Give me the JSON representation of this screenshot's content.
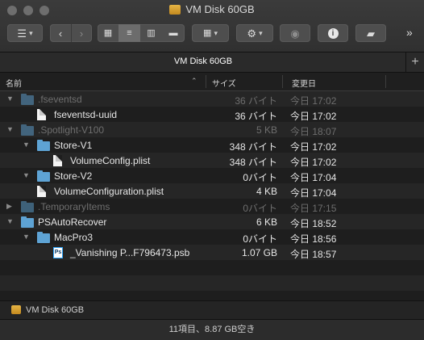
{
  "window": {
    "title": "VM Disk 60GB"
  },
  "tab": {
    "label": "VM Disk 60GB",
    "add_label": "+"
  },
  "toolbar": {
    "overflow_label": "»"
  },
  "columns": {
    "name": "名前",
    "size": "サイズ",
    "modified": "変更日"
  },
  "rows": [
    {
      "name": ".fseventsd",
      "size": "36 バイト",
      "date": "今日 17:02",
      "kind": "folder",
      "depth": 0,
      "expanded": true,
      "dim": true
    },
    {
      "name": "fseventsd-uuid",
      "size": "36 バイト",
      "date": "今日 17:02",
      "kind": "file",
      "depth": 1,
      "expanded": false,
      "dim": false
    },
    {
      "name": ".Spotlight-V100",
      "size": "5 KB",
      "date": "今日 18:07",
      "kind": "folder",
      "depth": 0,
      "expanded": true,
      "dim": true
    },
    {
      "name": "Store-V1",
      "size": "348 バイト",
      "date": "今日 17:02",
      "kind": "folder",
      "depth": 1,
      "expanded": true,
      "dim": false
    },
    {
      "name": "VolumeConfig.plist",
      "size": "348 バイト",
      "date": "今日 17:02",
      "kind": "file",
      "depth": 2,
      "expanded": false,
      "dim": false
    },
    {
      "name": "Store-V2",
      "size": "0バイト",
      "date": "今日 17:04",
      "kind": "folder",
      "depth": 1,
      "expanded": true,
      "dim": false
    },
    {
      "name": "VolumeConfiguration.plist",
      "size": "4 KB",
      "date": "今日 17:04",
      "kind": "file",
      "depth": 1,
      "expanded": false,
      "dim": false
    },
    {
      "name": ".TemporaryItems",
      "size": "0バイト",
      "date": "今日 17:15",
      "kind": "folder",
      "depth": 0,
      "expanded": false,
      "dim": true
    },
    {
      "name": "PSAutoRecover",
      "size": "6 KB",
      "date": "今日 18:52",
      "kind": "folder",
      "depth": 0,
      "expanded": true,
      "dim": false
    },
    {
      "name": "MacPro3",
      "size": "0バイト",
      "date": "今日 18:56",
      "kind": "folder",
      "depth": 1,
      "expanded": true,
      "dim": false
    },
    {
      "name": "_Vanishing P...F796473.psb",
      "size": "1.07 GB",
      "date": "今日 18:57",
      "kind": "psd",
      "depth": 2,
      "expanded": false,
      "dim": false
    }
  ],
  "pathbar": {
    "label": "VM Disk 60GB"
  },
  "status": {
    "text": "11項目、8.87 GB空き"
  },
  "colors": {
    "folder": "#5ea3d4",
    "background": "#1e1e1e",
    "psd_border": "#31a8ff"
  }
}
